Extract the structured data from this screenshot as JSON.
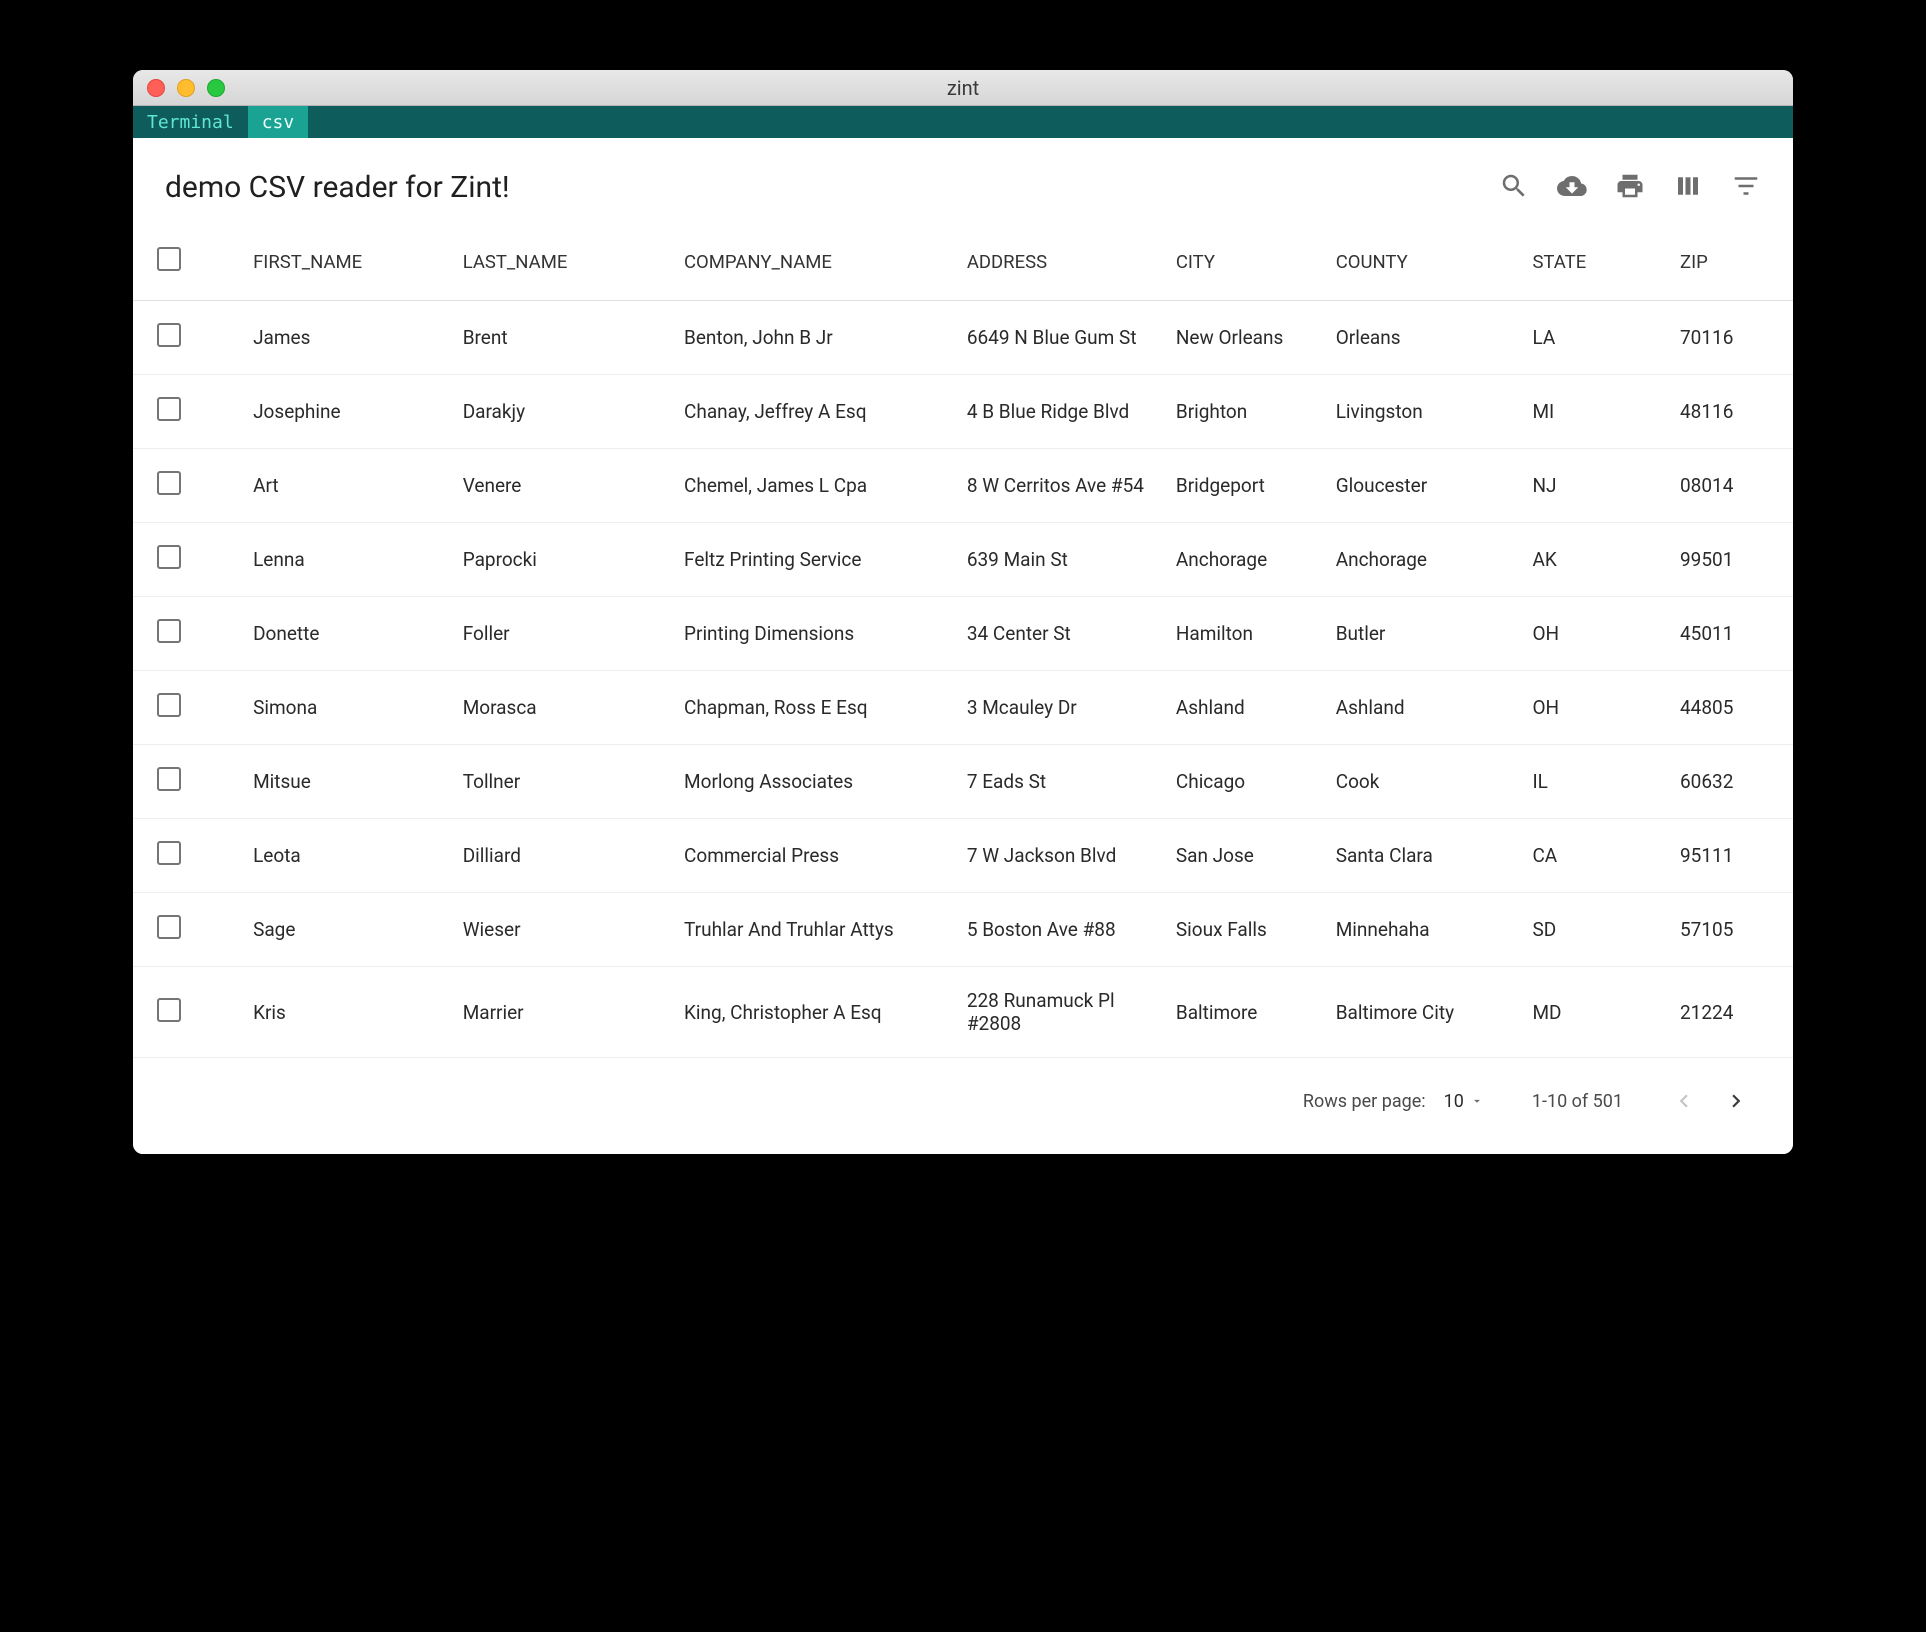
{
  "window": {
    "title": "zint"
  },
  "tabs": [
    {
      "label": "Terminal",
      "active": false
    },
    {
      "label": "csv",
      "active": true
    }
  ],
  "page": {
    "title": "demo CSV reader for Zint!"
  },
  "toolbar_icons": [
    "search",
    "download-cloud",
    "print",
    "columns",
    "filter"
  ],
  "columns": [
    "FIRST_NAME",
    "LAST_NAME",
    "COMPANY_NAME",
    "ADDRESS",
    "CITY",
    "COUNTY",
    "STATE",
    "ZIP"
  ],
  "rows": [
    {
      "first_name": "James",
      "last_name": "Brent",
      "company_name": "Benton, John B Jr",
      "address": "6649 N Blue Gum St",
      "city": "New Orleans",
      "county": "Orleans",
      "state": "LA",
      "zip": "70116"
    },
    {
      "first_name": "Josephine",
      "last_name": "Darakjy",
      "company_name": "Chanay, Jeffrey A Esq",
      "address": "4 B Blue Ridge Blvd",
      "city": "Brighton",
      "county": "Livingston",
      "state": "MI",
      "zip": "48116"
    },
    {
      "first_name": "Art",
      "last_name": "Venere",
      "company_name": "Chemel, James L Cpa",
      "address": "8 W Cerritos Ave #54",
      "city": "Bridgeport",
      "county": "Gloucester",
      "state": "NJ",
      "zip": "08014"
    },
    {
      "first_name": "Lenna",
      "last_name": "Paprocki",
      "company_name": "Feltz Printing Service",
      "address": "639 Main St",
      "city": "Anchorage",
      "county": "Anchorage",
      "state": "AK",
      "zip": "99501"
    },
    {
      "first_name": "Donette",
      "last_name": "Foller",
      "company_name": "Printing Dimensions",
      "address": "34 Center St",
      "city": "Hamilton",
      "county": "Butler",
      "state": "OH",
      "zip": "45011"
    },
    {
      "first_name": "Simona",
      "last_name": "Morasca",
      "company_name": "Chapman, Ross E Esq",
      "address": "3 Mcauley Dr",
      "city": "Ashland",
      "county": "Ashland",
      "state": "OH",
      "zip": "44805"
    },
    {
      "first_name": "Mitsue",
      "last_name": "Tollner",
      "company_name": "Morlong Associates",
      "address": "7 Eads St",
      "city": "Chicago",
      "county": "Cook",
      "state": "IL",
      "zip": "60632"
    },
    {
      "first_name": "Leota",
      "last_name": "Dilliard",
      "company_name": "Commercial Press",
      "address": "7 W Jackson Blvd",
      "city": "San Jose",
      "county": "Santa Clara",
      "state": "CA",
      "zip": "95111"
    },
    {
      "first_name": "Sage",
      "last_name": "Wieser",
      "company_name": "Truhlar And Truhlar Attys",
      "address": "5 Boston Ave #88",
      "city": "Sioux Falls",
      "county": "Minnehaha",
      "state": "SD",
      "zip": "57105"
    },
    {
      "first_name": "Kris",
      "last_name": "Marrier",
      "company_name": "King, Christopher A Esq",
      "address": "228 Runamuck Pl #2808",
      "city": "Baltimore",
      "county": "Baltimore City",
      "state": "MD",
      "zip": "21224"
    }
  ],
  "pagination": {
    "rows_per_page_label": "Rows per page:",
    "rows_per_page_value": "10",
    "range_text": "1-10 of 501",
    "prev_enabled": false,
    "next_enabled": true
  }
}
